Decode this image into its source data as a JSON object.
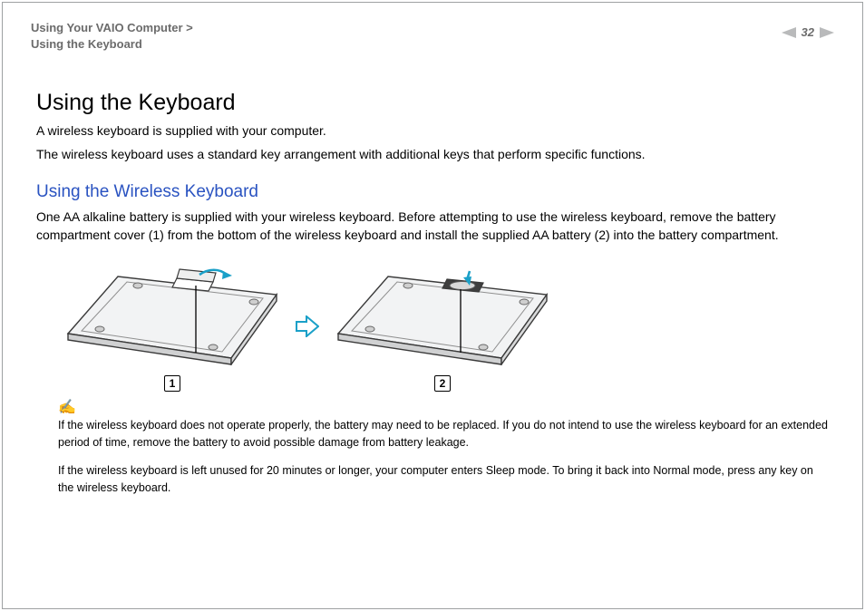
{
  "header": {
    "breadcrumb_line1": "Using Your VAIO Computer >",
    "breadcrumb_line2": "Using the Keyboard",
    "page_number": "32"
  },
  "title": "Using the Keyboard",
  "intro_p1": "A wireless keyboard is supplied with your computer.",
  "intro_p2": "The wireless keyboard uses a standard key arrangement with additional keys that perform specific functions.",
  "section_title": "Using the Wireless Keyboard",
  "section_body": "One AA alkaline battery is supplied with your wireless keyboard. Before attempting to use the wireless keyboard, remove the battery compartment cover (1) from the bottom of the wireless keyboard and install the supplied AA battery (2) into the battery compartment.",
  "callouts": {
    "left": "1",
    "right": "2"
  },
  "note1": "If the wireless keyboard does not operate properly, the battery may need to be replaced. If you do not intend to use the wireless keyboard for an extended period of time, remove the battery to avoid possible damage from battery leakage.",
  "note2": "If the wireless keyboard is left unused for 20 minutes or longer, your computer enters Sleep mode. To bring it back into Normal mode, press any key on the wireless keyboard."
}
